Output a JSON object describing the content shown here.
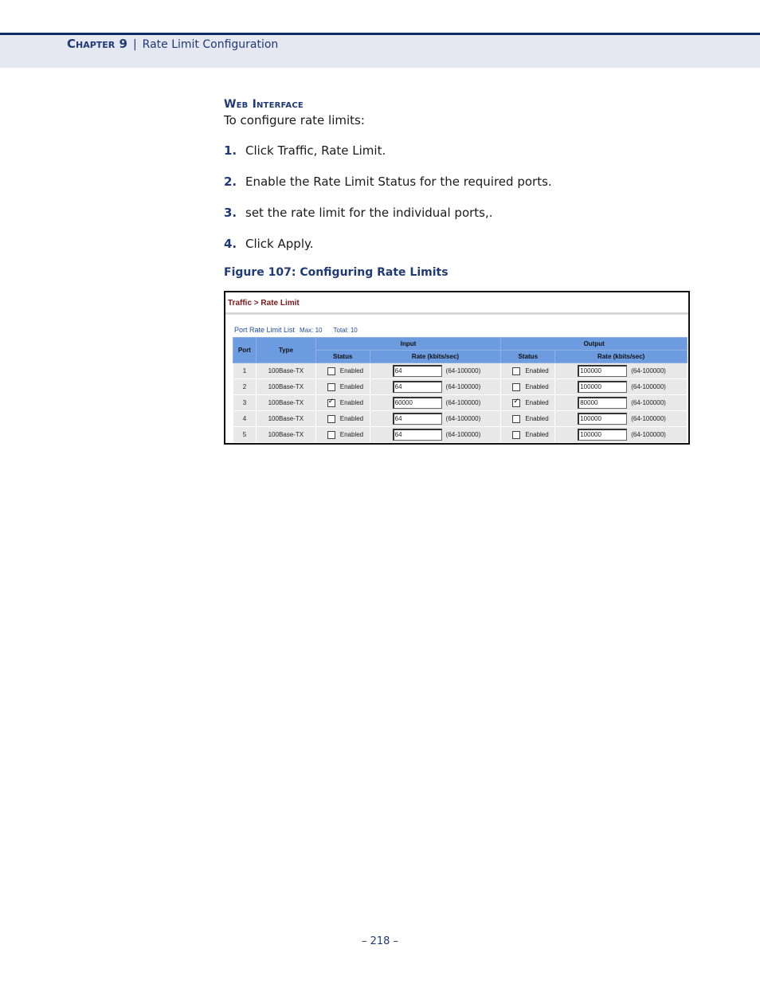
{
  "header": {
    "chapter": "Chapter 9",
    "separator": "|",
    "section": "Rate Limit Configuration"
  },
  "section_title": "Web Interface",
  "intro": "To configure rate limits:",
  "steps": [
    {
      "num": "1.",
      "text": "Click Traffic, Rate Limit."
    },
    {
      "num": "2.",
      "text": "Enable the Rate Limit Status for the required ports."
    },
    {
      "num": "3.",
      "text": "set the rate limit for the individual ports,."
    },
    {
      "num": "4.",
      "text": "Click Apply."
    }
  ],
  "figure_caption": "Figure 107:  Configuring Rate Limits",
  "figure": {
    "breadcrumb": "Traffic > Rate Limit",
    "list_title": "Port Rate Limit List",
    "max": "Max: 10",
    "total": "Total: 10",
    "headers": {
      "port": "Port",
      "type": "Type",
      "input": "Input",
      "output": "Output",
      "status": "Status",
      "rate": "Rate (kbits/sec)"
    },
    "enabled_label": "Enabled",
    "range_label": "(64-100000)",
    "rows": [
      {
        "port": "1",
        "type": "100Base-TX",
        "in_enabled": false,
        "in_rate": "64",
        "out_enabled": false,
        "out_rate": "100000"
      },
      {
        "port": "2",
        "type": "100Base-TX",
        "in_enabled": false,
        "in_rate": "64",
        "out_enabled": false,
        "out_rate": "100000"
      },
      {
        "port": "3",
        "type": "100Base-TX",
        "in_enabled": true,
        "in_rate": "60000",
        "out_enabled": true,
        "out_rate": "80000"
      },
      {
        "port": "4",
        "type": "100Base-TX",
        "in_enabled": false,
        "in_rate": "64",
        "out_enabled": false,
        "out_rate": "100000"
      },
      {
        "port": "5",
        "type": "100Base-TX",
        "in_enabled": false,
        "in_rate": "64",
        "out_enabled": false,
        "out_rate": "100000"
      }
    ]
  },
  "page_number": "–  218  –"
}
